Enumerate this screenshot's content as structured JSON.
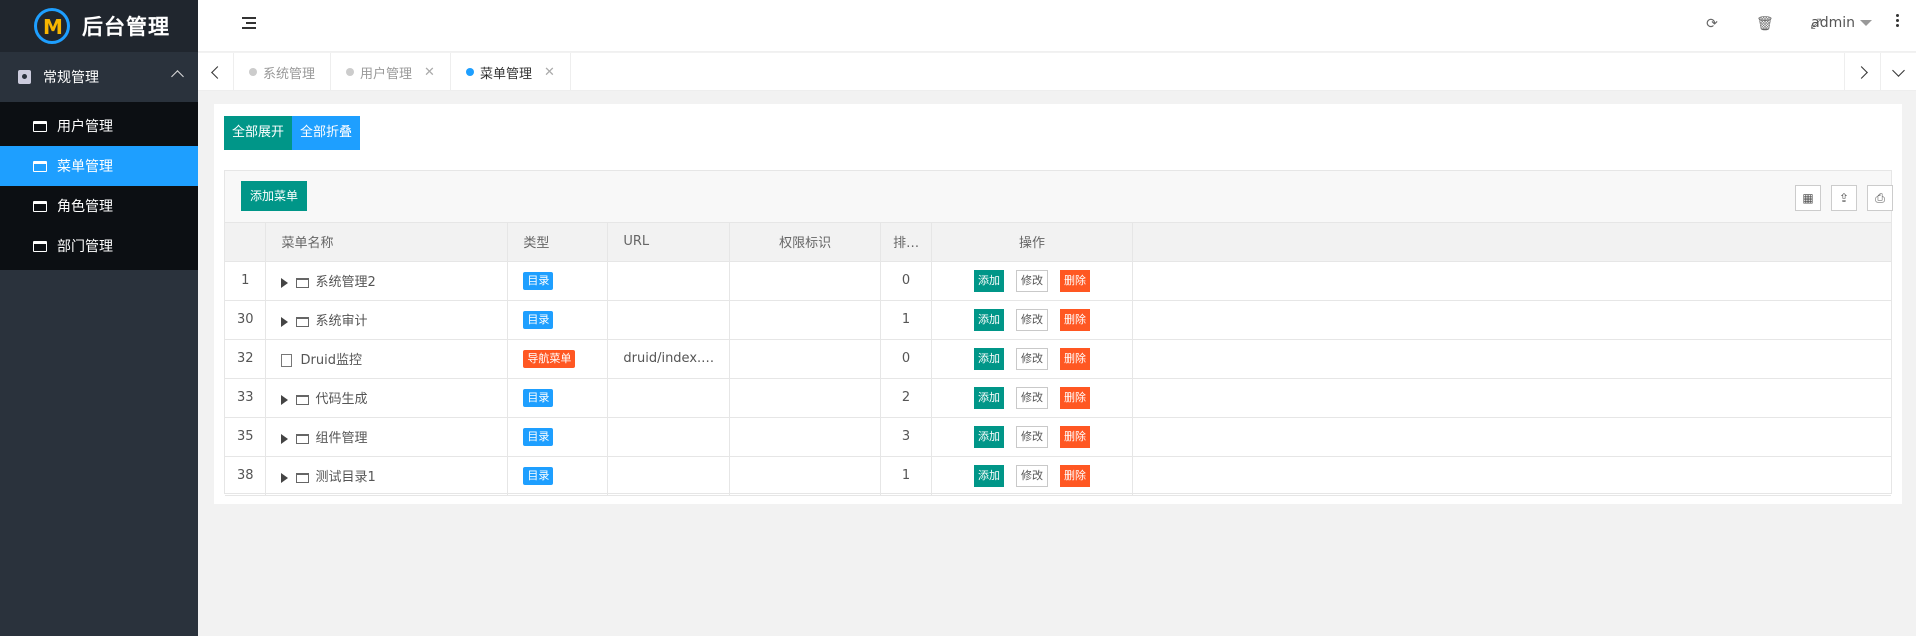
{
  "app": {
    "title": "后台管理",
    "logo_letters": "M"
  },
  "sidebar": {
    "group_label": "常规管理",
    "items": [
      {
        "label": "用户管理",
        "active": false
      },
      {
        "label": "菜单管理",
        "active": true
      },
      {
        "label": "角色管理",
        "active": false
      },
      {
        "label": "部门管理",
        "active": false
      }
    ]
  },
  "header": {
    "user": "admin"
  },
  "tabs": [
    {
      "label": "系统管理",
      "active": false,
      "closable": false
    },
    {
      "label": "用户管理",
      "active": false,
      "closable": true
    },
    {
      "label": "菜单管理",
      "active": true,
      "closable": true
    }
  ],
  "toolbar": {
    "expand_all": "全部展开",
    "collapse_all": "全部折叠",
    "add_menu": "添加菜单"
  },
  "table": {
    "columns": [
      "菜单名称",
      "类型",
      "URL",
      "权限标识",
      "排…",
      "操作"
    ],
    "rows": [
      {
        "id": "1",
        "name": "系统管理2",
        "type": "目录",
        "url": "",
        "perm": "",
        "order": "0",
        "expandable": true
      },
      {
        "id": "30",
        "name": "系统审计",
        "type": "目录",
        "url": "",
        "perm": "",
        "order": "1",
        "expandable": true
      },
      {
        "id": "32",
        "name": "Druid监控",
        "type": "导航菜单",
        "url": "druid/index.…",
        "perm": "",
        "order": "0",
        "expandable": false
      },
      {
        "id": "33",
        "name": "代码生成",
        "type": "目录",
        "url": "",
        "perm": "",
        "order": "2",
        "expandable": true
      },
      {
        "id": "35",
        "name": "组件管理",
        "type": "目录",
        "url": "",
        "perm": "",
        "order": "3",
        "expandable": true
      },
      {
        "id": "38",
        "name": "测试目录1",
        "type": "目录",
        "url": "",
        "perm": "",
        "order": "1",
        "expandable": true
      }
    ],
    "actions": {
      "add": "添加",
      "edit": "修改",
      "delete": "删除"
    }
  },
  "colors": {
    "accent_blue": "#1e9fff",
    "teal": "#009688",
    "orange": "#ff5722",
    "sidebar": "#2a323c"
  }
}
